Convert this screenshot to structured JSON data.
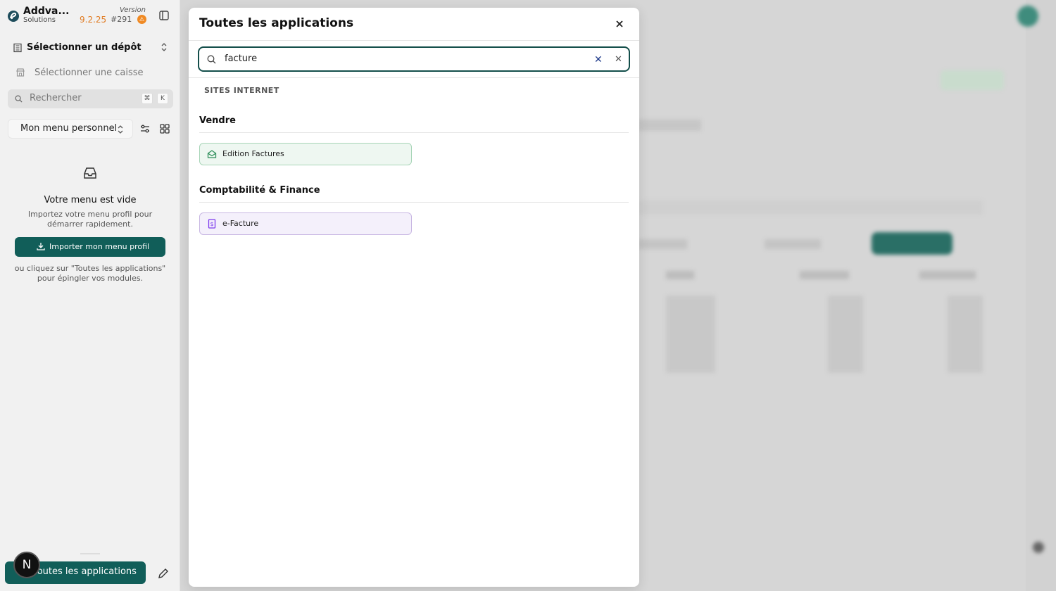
{
  "sidebar": {
    "brand_name": "Addva...",
    "brand_sub": "Solutions",
    "version_label": "Version",
    "version_number": "9.2.25",
    "version_build": "#291",
    "version_warn": "⚠",
    "depot_label": "Sélectionner un dépôt",
    "caisse_label": "Sélectionner une caisse",
    "search_placeholder": "Rechercher",
    "search_kbd_cmd": "⌘",
    "search_kbd_k": "K",
    "menu_select_label": "Mon menu personnel",
    "empty_title": "Votre menu est vide",
    "empty_desc": "Importez votre menu profil pour démarrer rapidement.",
    "import_button": "Importer mon menu profil",
    "empty_hint": "ou cliquez sur \"Toutes les applications\" pour épingler vos modules.",
    "all_apps_button": "Toutes les applications",
    "avatar_letter": "N"
  },
  "modal": {
    "title": "Toutes les applications",
    "search_value": "facture",
    "section_label": "SITES INTERNET",
    "groups": [
      {
        "title": "Vendre",
        "apps": [
          {
            "label": "Edition Factures",
            "icon": "envelope-open-icon",
            "color": "#2f8f5b"
          }
        ]
      },
      {
        "title": "Comptabilité & Finance",
        "apps": [
          {
            "label": "e-Facture",
            "icon": "invoice-dollar-icon",
            "color": "#7c3aed"
          }
        ]
      }
    ]
  },
  "colors": {
    "primary": "#115e59",
    "accent_orange": "#e07b22",
    "focus_border": "#134e4a"
  }
}
